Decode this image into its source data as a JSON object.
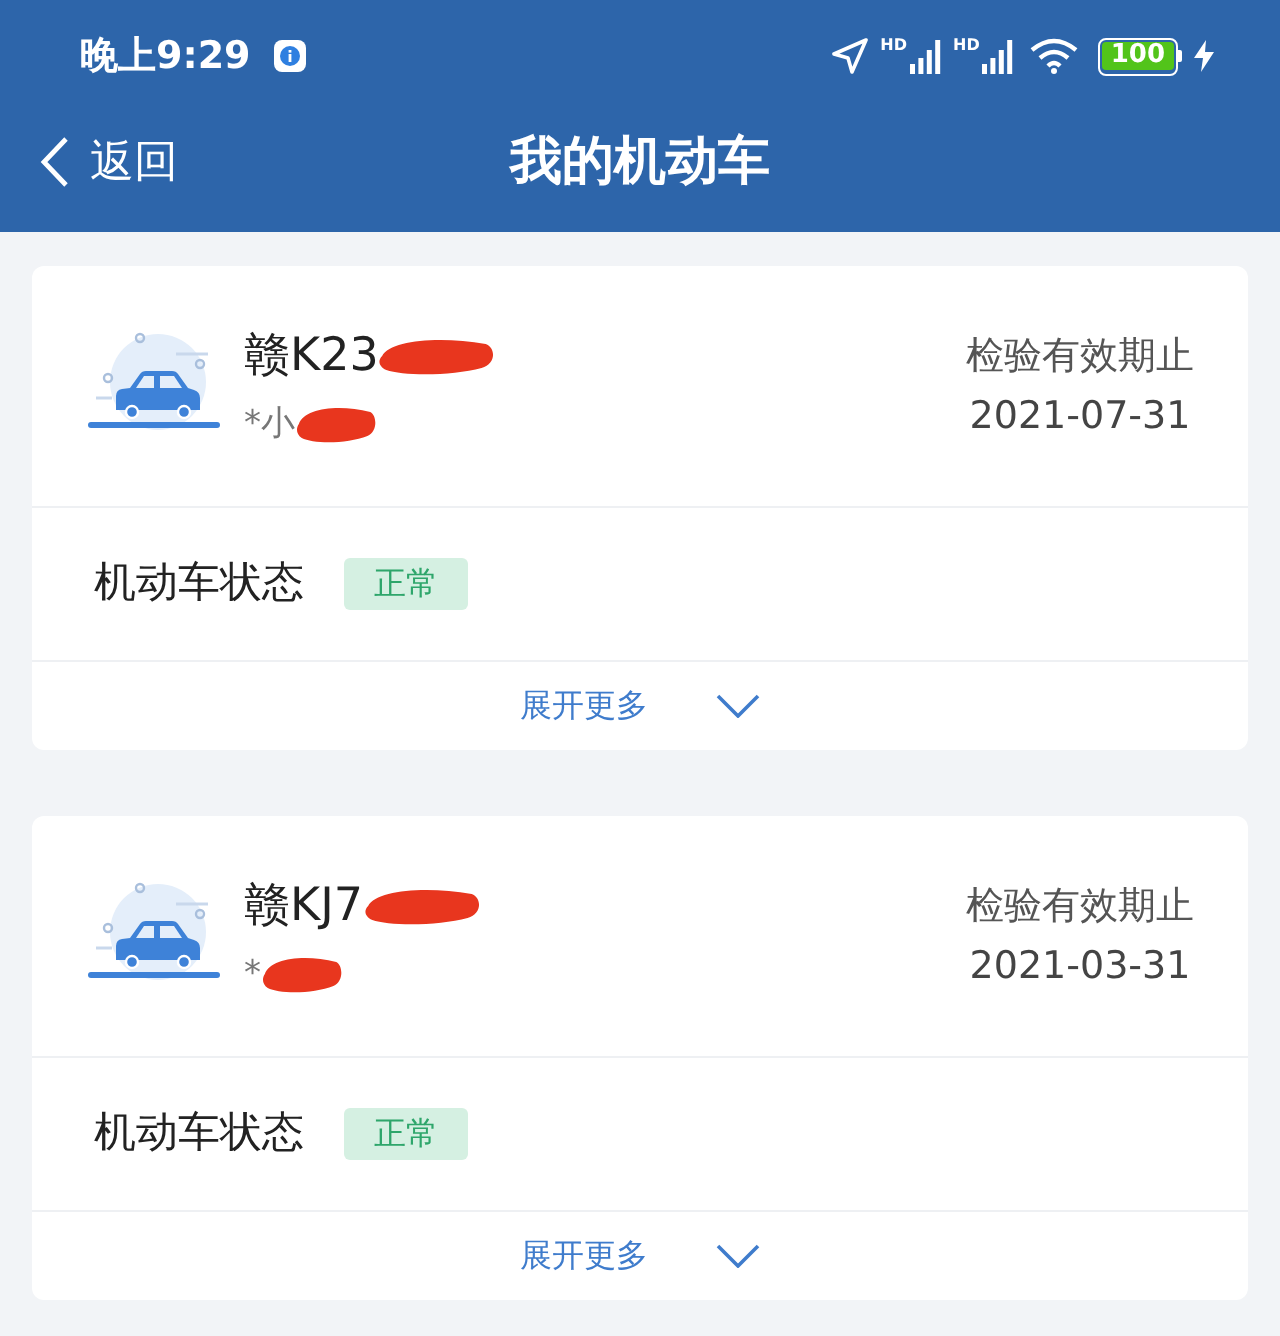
{
  "status_bar": {
    "time": "晚上9:29",
    "signals": [
      {
        "label": "HD"
      },
      {
        "label": "HD"
      }
    ],
    "battery": "100"
  },
  "nav": {
    "back": "返回",
    "title": "我的机动车"
  },
  "vehicles": [
    {
      "plate": "赣K23",
      "plate_redacted": true,
      "owner": "*小",
      "owner_redacted": true,
      "expiry_label": "检验有效期止",
      "expiry_date": "2021-07-31",
      "status_label": "机动车状态",
      "status": "正常",
      "expand": "展开更多",
      "expanded": false
    },
    {
      "plate": "赣KJ7",
      "plate_redacted": true,
      "owner": "*",
      "owner_redacted": true,
      "expiry_label": "检验有效期止",
      "expiry_date": "2021-03-31",
      "status_label": "机动车状态",
      "status": "正常",
      "expand": "展开更多",
      "expanded": false
    }
  ]
}
